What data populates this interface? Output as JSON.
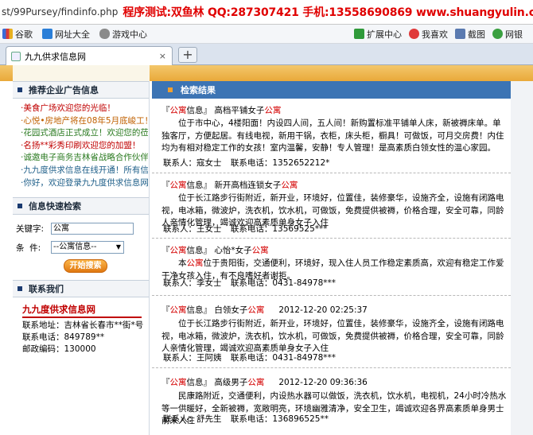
{
  "browser": {
    "url_path": "st/99Pursey/findinfo.php",
    "url_ad": "程序测试:双鱼林 QQ:287307421 手机:13558690869 www.shuangyulin.com",
    "bookmarks": [
      "谷歌",
      "网址大全",
      "游戏中心"
    ],
    "tools": [
      "扩展中心",
      "我喜欢",
      "截图",
      "网银"
    ],
    "tab_title": "九九供求信息网",
    "tab_close": "×",
    "new_tab": "+"
  },
  "sidebar": {
    "ads_heading": "推荐企业广告信息",
    "ads": [
      {
        "text": "·美食广场欢迎您的光临！",
        "color": "#c00000"
      },
      {
        "text": "·心悦•房地产将在08年5月底峻工！",
        "color": "#c06000"
      },
      {
        "text": "·花园式酒店正式成立！欢迎您的莅...",
        "color": "#2a7a20"
      },
      {
        "text": "·名扬**彩秀印刷欢迎您的加盟！",
        "color": "#c00000"
      },
      {
        "text": "·诚邀电子商务吉林省战略合作伙伴",
        "color": "#2a7a20"
      },
      {
        "text": "·九九度供求信息在线开通！所有信...",
        "color": "#20608a"
      },
      {
        "text": "·你好，欢迎登录九九度供求信息网...",
        "color": "#20608a"
      }
    ],
    "search_heading": "信息快速检索",
    "keyword_label": "关键字:",
    "keyword_value": "公寓",
    "condition_label": "条  件:",
    "condition_value": "--公寓信息--",
    "search_button": "开始搜索",
    "contact_heading": "联系我们",
    "contact_title": "九九度供求信息网",
    "contact_lines": [
      "联系地址：吉林省长春市**街*号",
      "联系电话：849789**",
      "邮政编码：130000"
    ]
  },
  "main": {
    "heading": "检索结果",
    "entries": [
      {
        "prefix": "『",
        "cat_hl": "公寓",
        "cat_rest": "信息』",
        "title_pre": "高档平铺女子",
        "title_hl": "公寓",
        "time": "",
        "desc": "位于市中心，4楼阳面！内设四人间，五人间！新购置标准平铺单人床，新被褥床单。单独客厅，方便起居。有线电视，新用干锅，衣柜，床头柜，橱具！可做饭，可月交房费！内住均为有相对稳定工作的女孩！室内温馨，安静！专人管理！是高素质白领女性的温心家园。",
        "contact_person": "联系人：寇女士",
        "contact_phone": "联系电话：1352652212*"
      },
      {
        "prefix": "『",
        "cat_hl": "公寓",
        "cat_rest": "信息』",
        "title_pre": "新开高档连锁女子",
        "title_hl": "公寓",
        "time": "",
        "desc": "位于长江路步行街附近，新开业，环境好，位置佳，装修豪华，设施齐全，设施有闭路电视，电冰箱，微波炉，洗衣机，饮水机，可做饭，免费提供被褥，价格合理，安全可靠，同龄人亲情化管理，竭诚欢迎高素质单身女子入住",
        "contact_person": "联系人：王女士",
        "contact_phone": "联系电话：13569525***"
      },
      {
        "prefix": "『",
        "cat_hl": "公寓",
        "cat_rest": "信息』",
        "title_pre": "心怡*女子",
        "title_hl": "公寓",
        "time": "",
        "desc_hl": "公寓",
        "desc": "位于贵阳街，交通便利，环境好，现入住人员工作稳定素质高，欢迎有稳定工作爱干净女孩入住，有不良嗜好者谢拒。",
        "desc_pre": "本",
        "contact_person": "联系人：李女士",
        "contact_phone": "联系电话：0431-84978***"
      },
      {
        "prefix": "『",
        "cat_hl": "公寓",
        "cat_rest": "信息』",
        "title_pre": "白领女子",
        "title_hl": "公寓",
        "time": "2012-12-20 02:25:37",
        "desc": "位于长江路步行街附近，新开业，环境好，位置佳，装修豪华，设施齐全，设施有闭路电视，电冰箱，微波炉，洗衣机，饮水机，可做饭，免费提供被褥，价格合理，安全可靠，同龄人亲情化管理，竭诚欢迎高素质单身女子入住",
        "contact_person": "联系人：王阿姨",
        "contact_phone": "联系电话：0431-84978***"
      },
      {
        "prefix": "『",
        "cat_hl": "公寓",
        "cat_rest": "信息』",
        "title_pre": "高级男子",
        "title_hl": "公寓",
        "time": "2012-12-20 09:36:36",
        "desc": "民康路附近，交通便利，内设热水器可以做饭，洗衣机，饮水机，电视机，24小时冷热水等一供暖好，全新被褥，宽敞明亮，环境幽雅清净，安全卫生，竭诚欢迎各界高素质单身男士前来入住",
        "contact_person": "联系人：舒先生",
        "contact_phone": "联系电话：136896525**"
      }
    ]
  },
  "colors": {
    "header_blue": "#3c74b4",
    "highlight_red": "#d40000",
    "search_orange": "#f09020"
  }
}
